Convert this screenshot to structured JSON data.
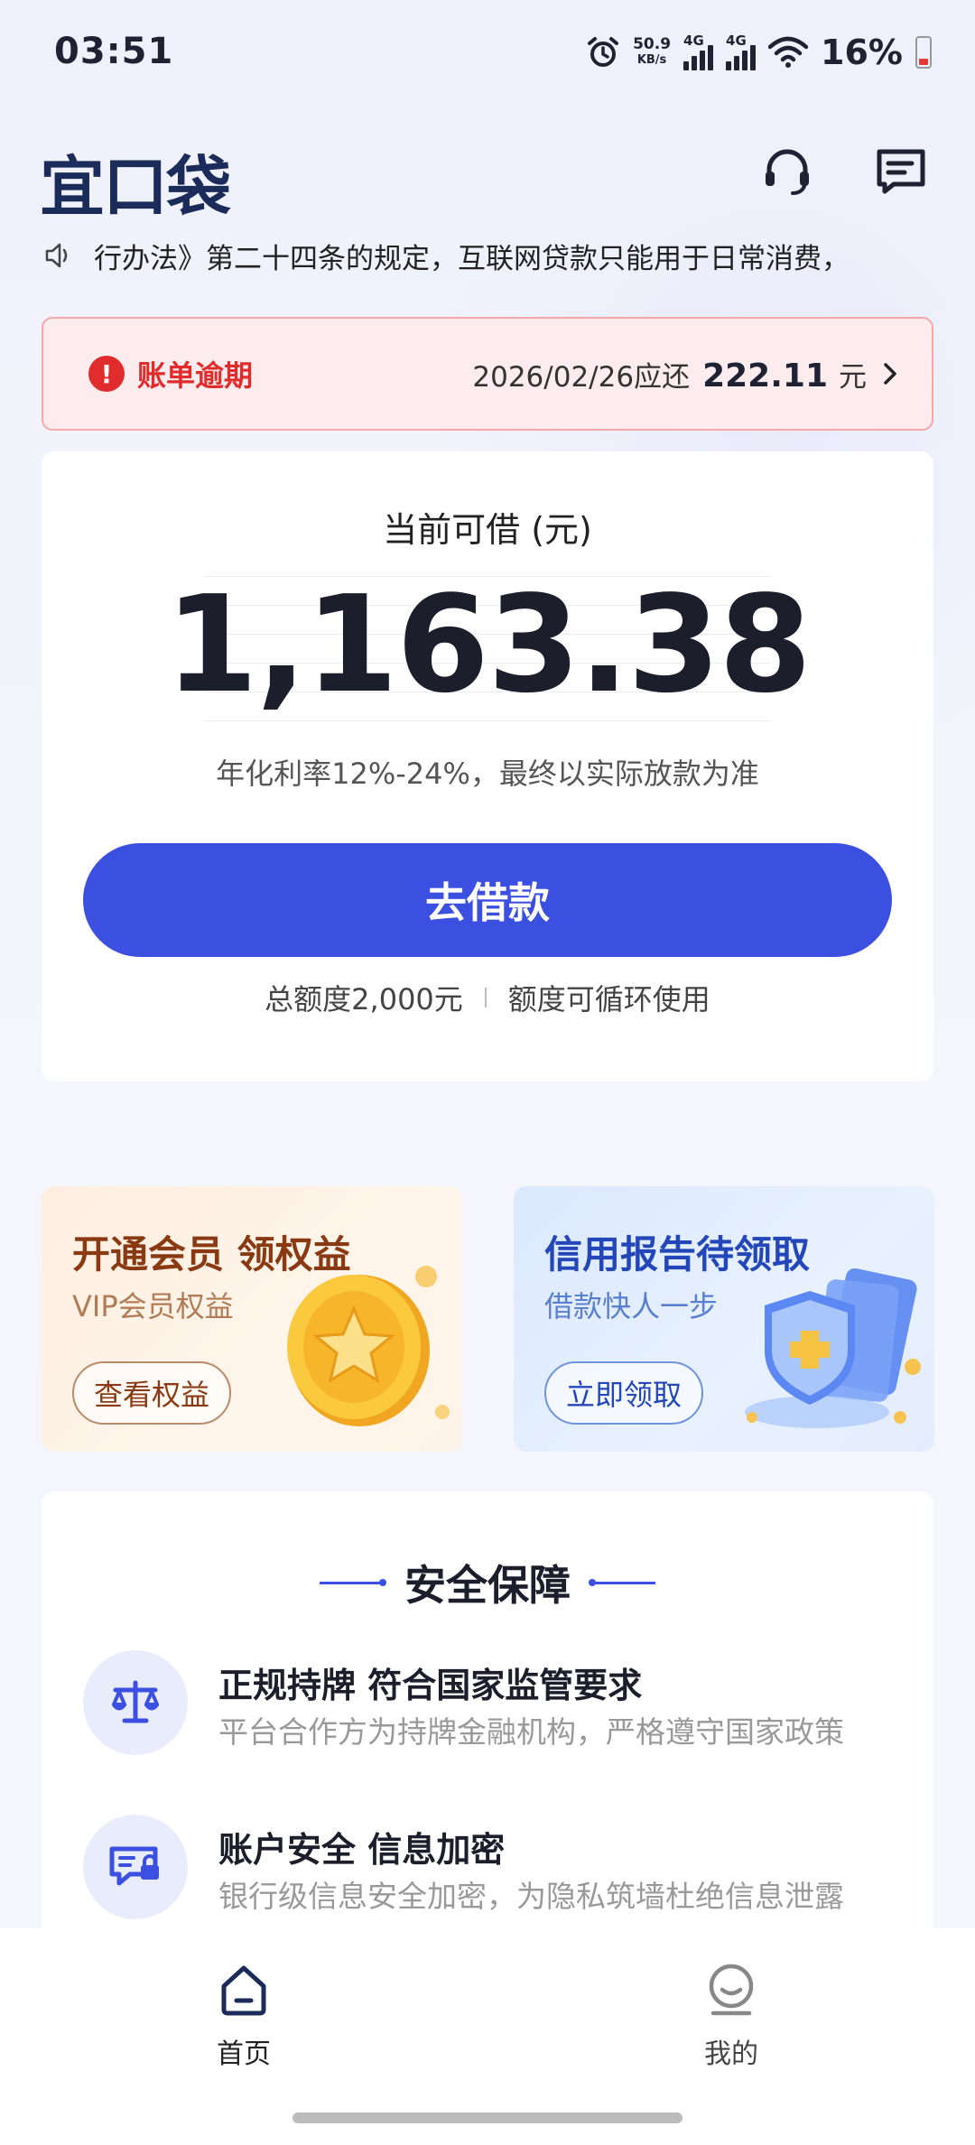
{
  "status_bar": {
    "time": "03:51",
    "net_speed_value": "50.9",
    "net_speed_unit": "KB/s",
    "signal1": "4G",
    "signal2": "4G",
    "battery": "16%"
  },
  "header": {
    "logo": "宜口袋"
  },
  "notice": {
    "text": "行办法》第二十四条的规定，互联网贷款只能用于日常消费，"
  },
  "overdue": {
    "label": "账单逾期",
    "date_text": "2026/02/26应还",
    "amount": "222.11",
    "unit": "元"
  },
  "loan": {
    "available_label": "当前可借 (元)",
    "amount": "1,163.38",
    "rate": "年化利率12%-24%，最终以实际放款为准",
    "button": "去借款",
    "total_quota": "总额度2,000元",
    "cyclic": "额度可循环使用"
  },
  "promos": [
    {
      "title": "开通会员 领权益",
      "subtitle": "VIP会员权益",
      "button": "查看权益"
    },
    {
      "title": "信用报告待领取",
      "subtitle": "借款快人一步",
      "button": "立即领取"
    }
  ],
  "safety": {
    "title": "安全保障",
    "items": [
      {
        "title": "正规持牌 符合国家监管要求",
        "desc": "平台合作方为持牌金融机构，严格遵守国家政策"
      },
      {
        "title": "账户安全 信息加密",
        "desc": "银行级信息安全加密，为隐私筑墙杜绝信息泄露"
      }
    ]
  },
  "nav": {
    "home": "首页",
    "mine": "我的"
  },
  "colors": {
    "primary": "#3b4fe0",
    "alert": "#e02c2c",
    "logo": "#1b2c5a"
  }
}
